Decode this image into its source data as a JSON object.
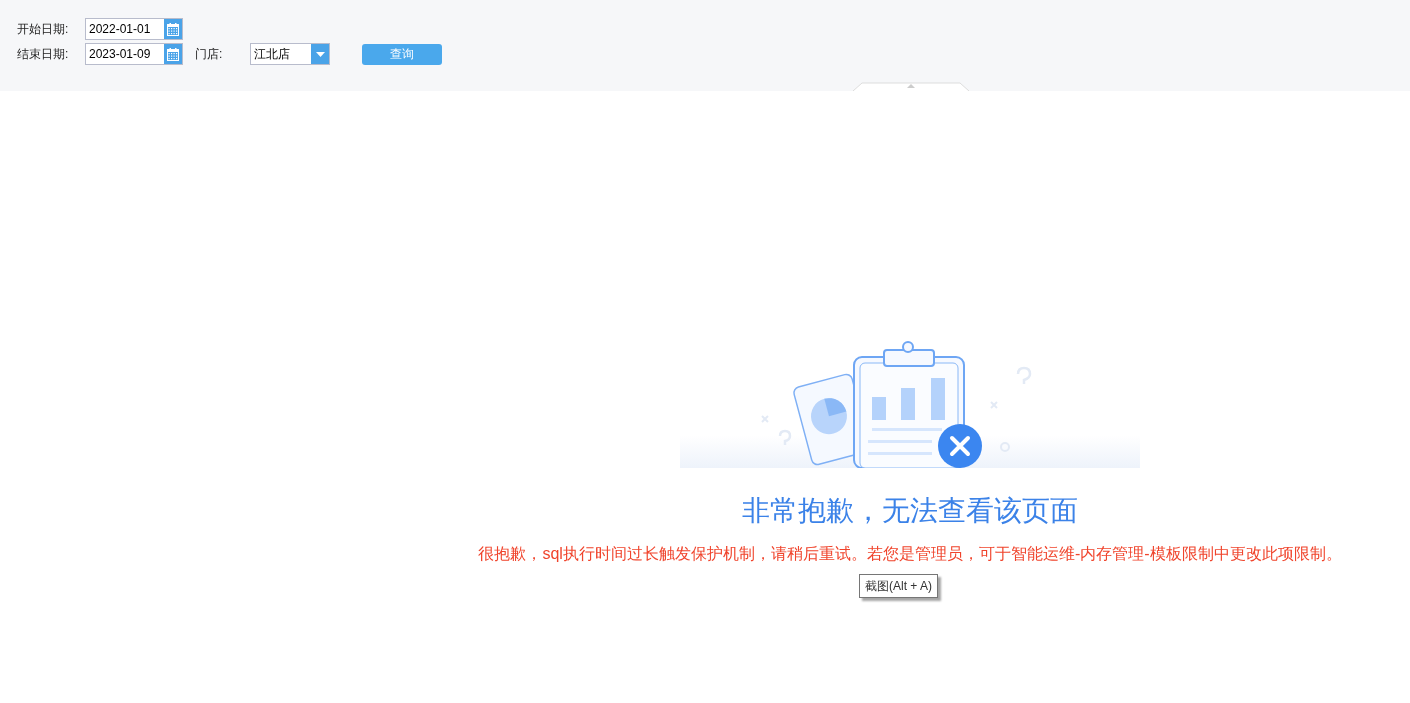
{
  "filters": {
    "start_date": {
      "label": "开始日期:",
      "value": "2022-01-01"
    },
    "end_date": {
      "label": "结束日期:",
      "value": "2023-01-09"
    },
    "store": {
      "label": "门店:",
      "value": "江北店"
    },
    "query_button": "查询"
  },
  "error": {
    "title": "非常抱歉，无法查看该页面",
    "message": "很抱歉，sql执行时间过长触发保护机制，请稍后重试。若您是管理员，可于智能运维-内存管理-模板限制中更改此项限制。"
  },
  "tooltip": "截图(Alt + A)"
}
